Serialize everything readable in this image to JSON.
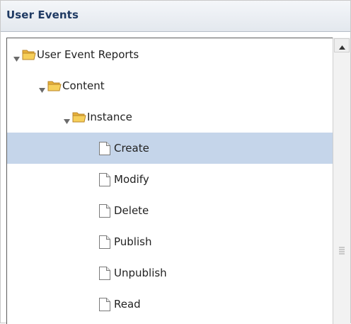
{
  "panel": {
    "title": "User Events"
  },
  "tree": {
    "root": {
      "label": "User Event Reports",
      "icon": "folder-open-icon",
      "expanded": true
    },
    "content": {
      "label": "Content",
      "icon": "folder-open-icon",
      "expanded": true
    },
    "instance": {
      "label": "Instance",
      "icon": "folder-open-icon",
      "expanded": true
    },
    "items": [
      {
        "label": "Create",
        "icon": "document-icon",
        "selected": true
      },
      {
        "label": "Modify",
        "icon": "document-icon",
        "selected": false
      },
      {
        "label": "Delete",
        "icon": "document-icon",
        "selected": false
      },
      {
        "label": "Publish",
        "icon": "document-icon",
        "selected": false
      },
      {
        "label": "Unpublish",
        "icon": "document-icon",
        "selected": false
      },
      {
        "label": "Read",
        "icon": "document-icon",
        "selected": false
      }
    ]
  },
  "colors": {
    "selection": "#c5d5ea",
    "title_text": "#1f3a63",
    "folder": "#f3c548"
  }
}
